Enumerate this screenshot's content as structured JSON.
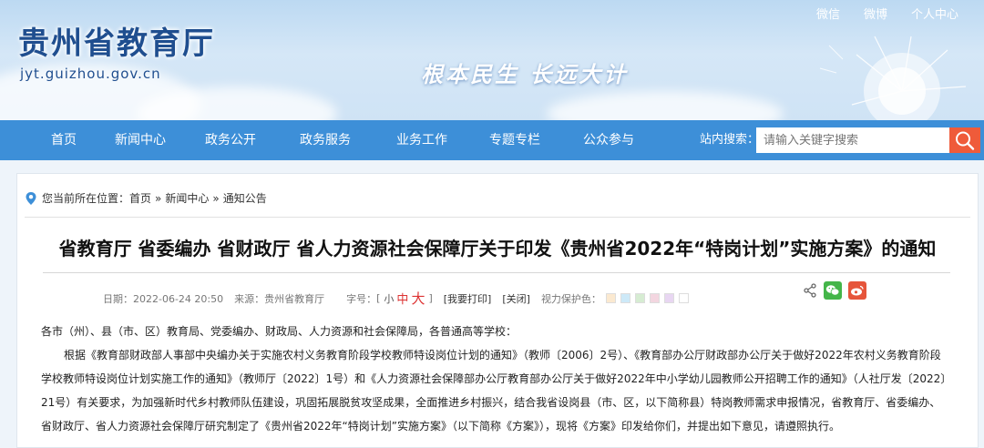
{
  "header": {
    "site_title": "贵州省教育厅",
    "site_domain": "jyt.guizhou.gov.cn",
    "slogan": "根本民生 长远大计",
    "top_links": [
      "微信",
      "微博",
      "个人中心"
    ]
  },
  "nav": {
    "items": [
      "首页",
      "新闻中心",
      "政务公开",
      "政务服务",
      "业务工作",
      "专题专栏",
      "公众参与"
    ],
    "search_label": "站内搜索：",
    "search_placeholder": "请输入关键字搜索"
  },
  "breadcrumb": {
    "prefix": "您当前所在位置：",
    "items": [
      "首页",
      "新闻中心",
      "通知公告"
    ],
    "separator": "»"
  },
  "article": {
    "title": "省教育厅 省委编办 省财政厅 省人力资源社会保障厅关于印发《贵州省2022年“特岗计划”实施方案》的通知",
    "meta": {
      "date": "日期：2022-06-24 20:50",
      "source": "来源：贵州省教育厅",
      "font_label": "字号：",
      "open": "[",
      "small": "小",
      "medium": "中",
      "large": "大",
      "close": "]",
      "print": "[我要打印]",
      "close_btn": "[关闭]",
      "eye_label": "视力保护色：",
      "eye_colors": [
        "#fbe9d0",
        "#cde9f8",
        "#d6ecd2",
        "#f3d6e0",
        "#e8d6f2",
        "#ffffff"
      ]
    },
    "paragraphs": [
      "各市（州）、县（市、区）教育局、党委编办、财政局、人力资源和社会保障局，各普通高等学校：",
      "根据《教育部财政部人事部中央编办关于实施农村义务教育阶段学校教师特设岗位计划的通知》（教师〔2006〕2号）、《教育部办公厅财政部办公厅关于做好2022年农村义务教育阶段学校教师特设岗位计划实施工作的通知》（教师厅〔2022〕1号）和《人力资源社会保障部办公厅教育部办公厅关于做好2022年中小学幼儿园教师公开招聘工作的通知》（人社厅发〔2022〕21号）有关要求，为加强新时代乡村教师队伍建设，巩固拓展脱贫攻坚成果，全面推进乡村振兴，结合我省设岗县（市、区，以下简称县）特岗教师需求申报情况，省教育厅、省委编办、省财政厅、省人力资源社会保障厅研究制定了《贵州省2022年“特岗计划”实施方案》（以下简称《方案》），现将《方案》印发给你们，并提出如下意见，请遵照执行。"
    ]
  },
  "colors": {
    "nav_bg": "#3d8fd8",
    "search_btn": "#ef5b3a",
    "title_blue": "#1f4e8f"
  }
}
